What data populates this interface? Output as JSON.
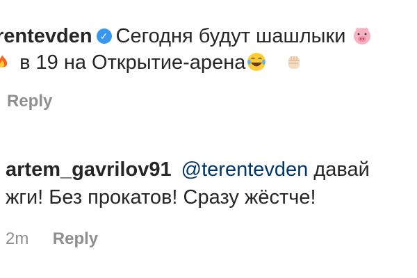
{
  "comments": [
    {
      "username": "rentevden",
      "verified": true,
      "text_line1": "Сегодня будут шашлыки",
      "text_line2_prefix": "в 19 на Открытие-арена",
      "emojis": [
        "pig-emoji",
        "fire-emoji",
        "tears-of-joy-emoji",
        "raised-fist-emoji"
      ],
      "reply_label": "Reply"
    },
    {
      "username": "artem_gavrilov91",
      "mention": "@terentevden",
      "text_line1_suffix": "давай",
      "text_line2": "жги! Без прокатов! Сразу жёстче!",
      "time": "2m",
      "reply_label": "Reply"
    }
  ]
}
